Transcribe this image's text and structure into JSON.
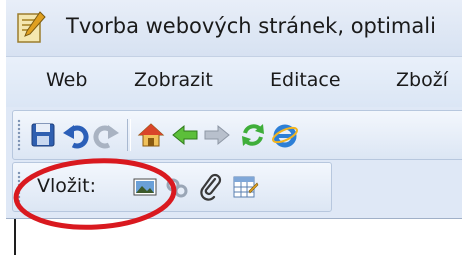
{
  "window": {
    "title": "Tvorba webových stránek, optimali",
    "app_icon": "document-pen-icon"
  },
  "menu": {
    "items": [
      "Web",
      "Zobrazit",
      "Editace",
      "Zboží"
    ]
  },
  "toolbar_main": {
    "icons": [
      "save-icon",
      "undo-icon",
      "redo-icon",
      "home-icon",
      "back-arrow-icon",
      "forward-arrow-icon",
      "refresh-icon",
      "internet-explorer-icon"
    ]
  },
  "toolbar_insert": {
    "label": "Vložit:",
    "icons": [
      "insert-image-icon",
      "insert-link-icon",
      "attachment-icon",
      "insert-table-icon"
    ]
  },
  "colors": {
    "annotation": "#d9191f",
    "chrome": "#dfe8f6"
  }
}
